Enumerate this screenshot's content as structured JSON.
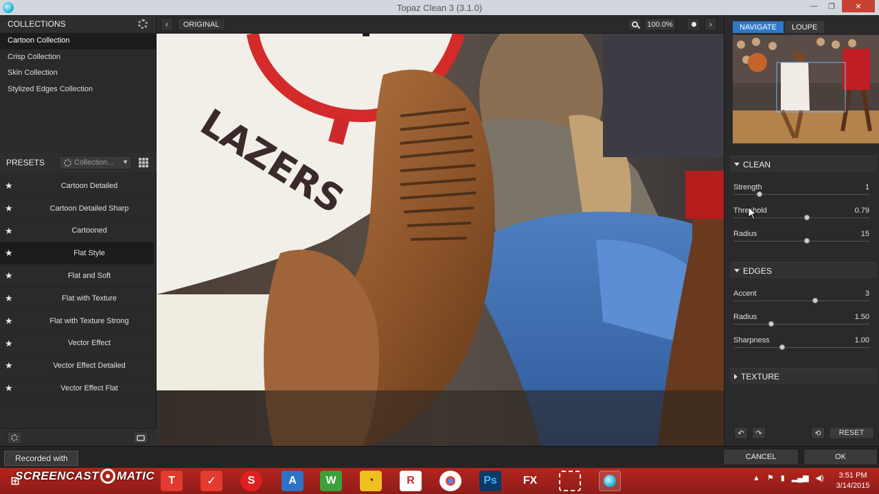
{
  "window": {
    "title": "Topaz Clean 3 (3.1.0)"
  },
  "collections": {
    "header": "COLLECTIONS",
    "items": [
      {
        "label": "Cartoon Collection",
        "selected": true
      },
      {
        "label": "Crisp Collection",
        "selected": false
      },
      {
        "label": "Skin Collection",
        "selected": false
      },
      {
        "label": "Stylized Edges Collection",
        "selected": false
      }
    ]
  },
  "presets": {
    "header": "PRESETS",
    "filter_label": "Collection...",
    "items": [
      {
        "label": "Cartoon Detailed",
        "selected": false
      },
      {
        "label": "Cartoon Detailed Sharp",
        "selected": false
      },
      {
        "label": "Cartooned",
        "selected": false
      },
      {
        "label": "Flat Style",
        "selected": true
      },
      {
        "label": "Flat and Soft",
        "selected": false
      },
      {
        "label": "Flat with Texture",
        "selected": false
      },
      {
        "label": "Flat with Texture Strong",
        "selected": false
      },
      {
        "label": "Vector Effect",
        "selected": false
      },
      {
        "label": "Vector Effect Detailed",
        "selected": false
      },
      {
        "label": "Vector Effect Flat",
        "selected": false
      }
    ]
  },
  "toolbar": {
    "original_label": "ORIGINAL",
    "zoom_level": "100.0%"
  },
  "navigator": {
    "tabs": [
      {
        "label": "NAVIGATE",
        "active": true
      },
      {
        "label": "LOUPE",
        "active": false
      }
    ]
  },
  "clean": {
    "header": "CLEAN",
    "sliders": [
      {
        "label": "Strength",
        "value": "1",
        "level": 0.19
      },
      {
        "label": "Threshold",
        "value": "0.79",
        "level": 0.54
      },
      {
        "label": "Radius",
        "value": "15",
        "level": 0.54
      }
    ]
  },
  "edges": {
    "header": "EDGES",
    "sliders": [
      {
        "label": "Accent",
        "value": "3",
        "level": 0.6
      },
      {
        "label": "Radius",
        "value": "1.50",
        "level": 0.28
      },
      {
        "label": "Sharpness",
        "value": "1.00",
        "level": 0.36
      }
    ]
  },
  "texture": {
    "header": "TEXTURE"
  },
  "actions": {
    "reset_label": "RESET",
    "cancel_label": "CANCEL",
    "ok_label": "OK"
  },
  "recording": {
    "label": "Recorded with",
    "watermark_left": "SCREENCAST",
    "watermark_right": "MATIC"
  },
  "clock": {
    "time": "3:51 PM",
    "date": "3/14/2015"
  },
  "colors": {
    "accent": "#2f79c8",
    "taskbar": "#a3221c",
    "close": "#c84031"
  }
}
